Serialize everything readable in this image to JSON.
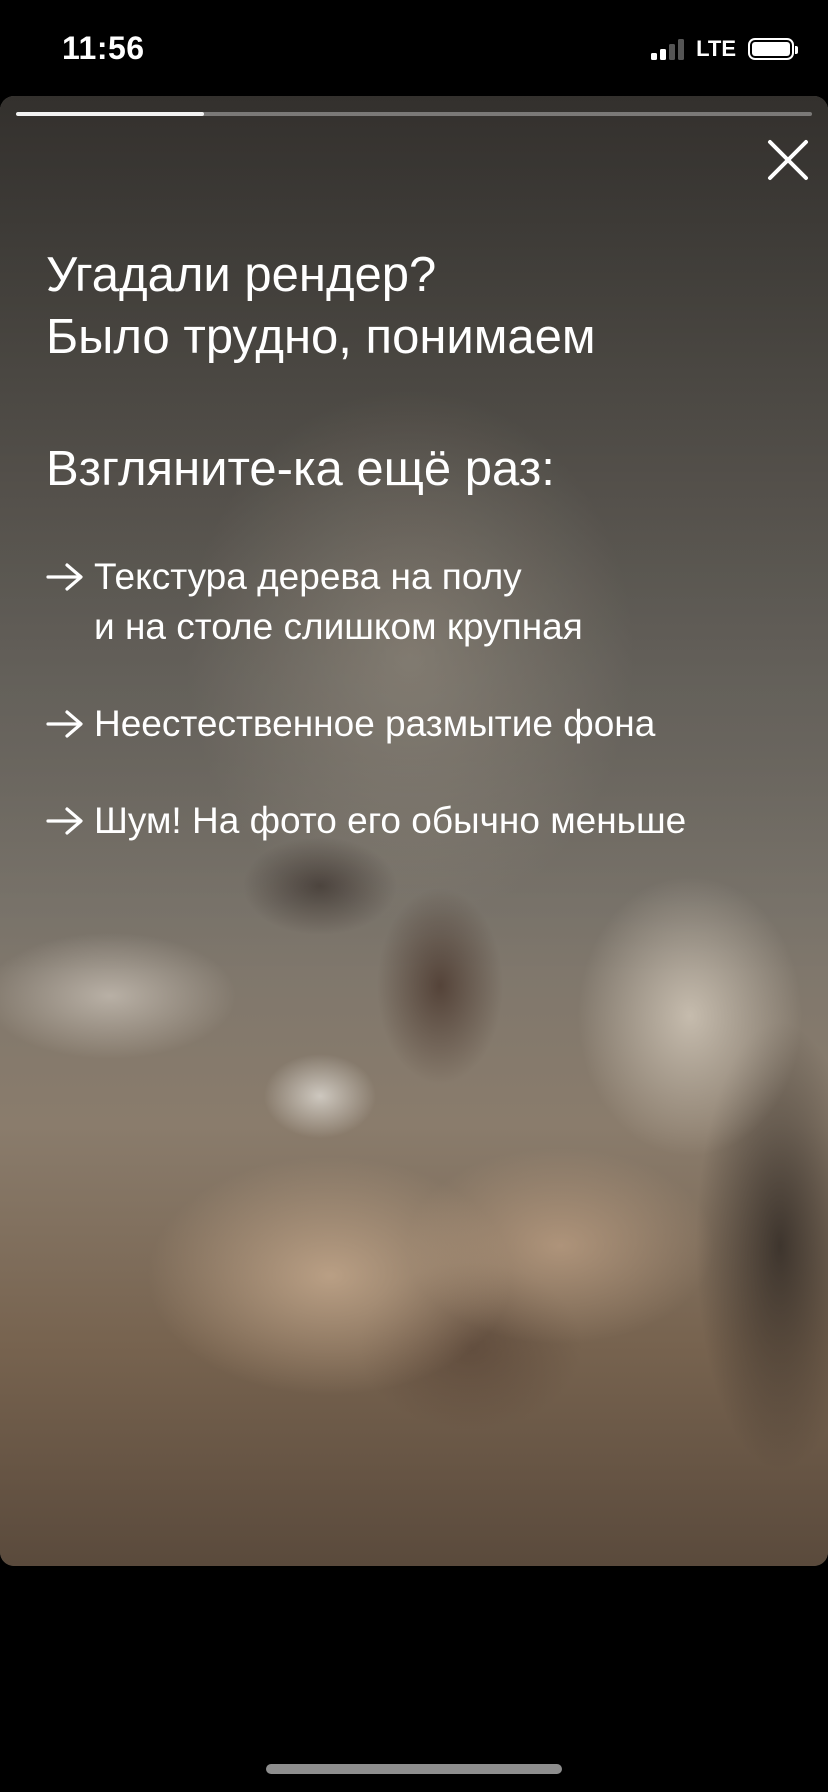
{
  "status_bar": {
    "time": "11:56",
    "network": "LTE",
    "signal_bars_active": 2,
    "signal_bars_total": 4,
    "battery_icon": "battery-full-icon"
  },
  "story": {
    "progress_fraction": 0.236,
    "close_icon": "close-icon",
    "title_line1": "Угадали рендер?",
    "title_line2": "Было трудно, понимаем",
    "subtitle": "Взгляните-ка ещё раз:",
    "items": [
      {
        "icon": "arrow-right-icon",
        "text": "Текстура дерева на полу\nи на столе слишком крупная"
      },
      {
        "icon": "arrow-right-icon",
        "text": "Неестественное размытие фона"
      },
      {
        "icon": "arrow-right-icon",
        "text": "Шум! На фото его обычно меньше"
      }
    ]
  },
  "colors": {
    "background": "#000000",
    "text": "#ffffff",
    "progress_track": "#8a8a8a",
    "progress_fill": "#f2f2f2"
  }
}
